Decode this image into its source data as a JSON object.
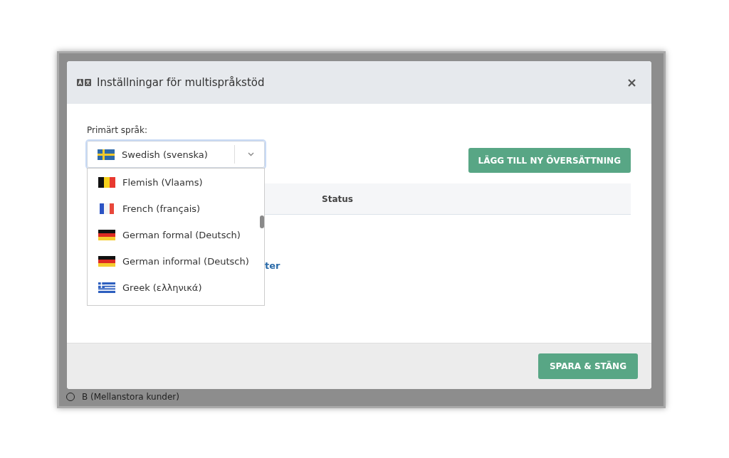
{
  "background": {
    "radio_label": "B (Mellanstora kunder)",
    "radio_checked": false
  },
  "dialog": {
    "title": "Inställningar för multispråkstöd",
    "primary_language": {
      "label": "Primärt språk:",
      "value": "Swedish (svenska)",
      "kind": "sweden",
      "expanded": true,
      "options": [
        {
          "label": "Flemish (Vlaams)",
          "kind": "belgium"
        },
        {
          "label": "French (français)",
          "kind": "france"
        },
        {
          "label": "German formal (Deutsch)",
          "kind": "germany"
        },
        {
          "label": "German informal (Deutsch)",
          "kind": "germany"
        },
        {
          "label": "Greek (ελληνικά)",
          "kind": "greece"
        }
      ]
    },
    "add_button": "LÄGG TILL NY ÖVERSÄTTNING",
    "table": {
      "columns": [
        "Status"
      ]
    },
    "link_fragment": "ter",
    "save_button": "SPARA & STÄNG"
  }
}
